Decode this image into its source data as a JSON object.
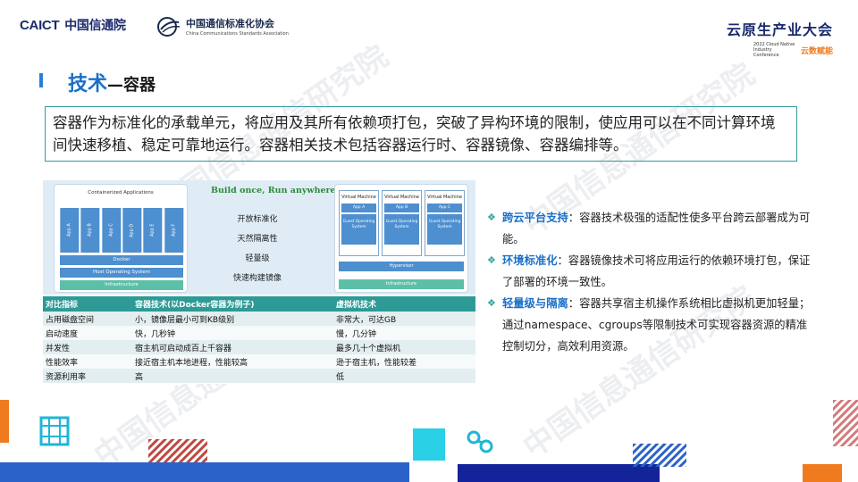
{
  "header": {
    "caict_en": "CAICT",
    "caict_cn": "中国信通院",
    "ccsa_cn": "中国通信标准化协会",
    "ccsa_en": "China Communications Standards Association",
    "conf_title": "云原生产业大会",
    "conf_sub": "2022 Cloud Native Industry Conference",
    "conf_slogan": "云数赋能"
  },
  "title": {
    "main": "技术",
    "sub": "—容器"
  },
  "intro": "容器作为标准化的承载单元，将应用及其所有依赖项打包，突破了异构环境的限制，使应用可以在不同计算环境间快速移植、稳定可靠地运行。容器相关技术包括容器运行时、容器镜像、容器编排等。",
  "diagram": {
    "containerized_label": "Containerized Applications",
    "apps": [
      "App A",
      "App B",
      "App C",
      "App D",
      "App E",
      "App F"
    ],
    "docker": "Docker",
    "host_os": "Host Operating System",
    "infrastructure": "Infrastructure",
    "slogan": "Build once, Run anywhere",
    "features": [
      "开放标准化",
      "天然隔离性",
      "轻量级",
      "快速构建镜像"
    ],
    "vms": [
      {
        "name": "Virtual Machine",
        "app": "App A",
        "os": "Guest Operating System"
      },
      {
        "name": "Virtual Machine",
        "app": "App B",
        "os": "Guest Operating System"
      },
      {
        "name": "Virtual Machine",
        "app": "App C",
        "os": "Guest Operating System"
      }
    ],
    "hypervisor": "Hypervisor",
    "vm_infrastructure": "Infrastructure"
  },
  "table": {
    "headers": [
      "对比指标",
      "容器技术(以Docker容器为例子)",
      "虚拟机技术"
    ],
    "rows": [
      [
        "占用磁盘空间",
        "小，镜像层最小可到KB级别",
        "非常大，可达GB"
      ],
      [
        "启动速度",
        "快，几秒钟",
        "慢，几分钟"
      ],
      [
        "并发性",
        "宿主机可启动成百上千容器",
        "最多几十个虚拟机"
      ],
      [
        "性能效率",
        "接近宿主机本地进程，性能较高",
        "逊于宿主机，性能较差"
      ],
      [
        "资源利用率",
        "高",
        "低"
      ]
    ]
  },
  "bullets": [
    {
      "marker": "❖",
      "keyword": "跨云平台支持",
      "text": "：容器技术极强的适配性使多平台跨云部署成为可能。"
    },
    {
      "marker": "❖",
      "keyword": "环境标准化",
      "text": "：容器镜像技术可将应用运行的依赖环境打包，保证了部署的环境一致性。"
    },
    {
      "marker": "❖",
      "keyword": "轻量级与隔离",
      "text": "：容器共享宿主机操作系统相比虚拟机更加轻量；通过namespace、cgroups等限制技术可实现容器资源的精准控制切分，高效利用资源。"
    }
  ],
  "watermark": "中国信息通信研究院",
  "colors": {
    "accent": "#1a6fc9",
    "teal": "#2e9a96",
    "orange": "#f07b1e"
  }
}
